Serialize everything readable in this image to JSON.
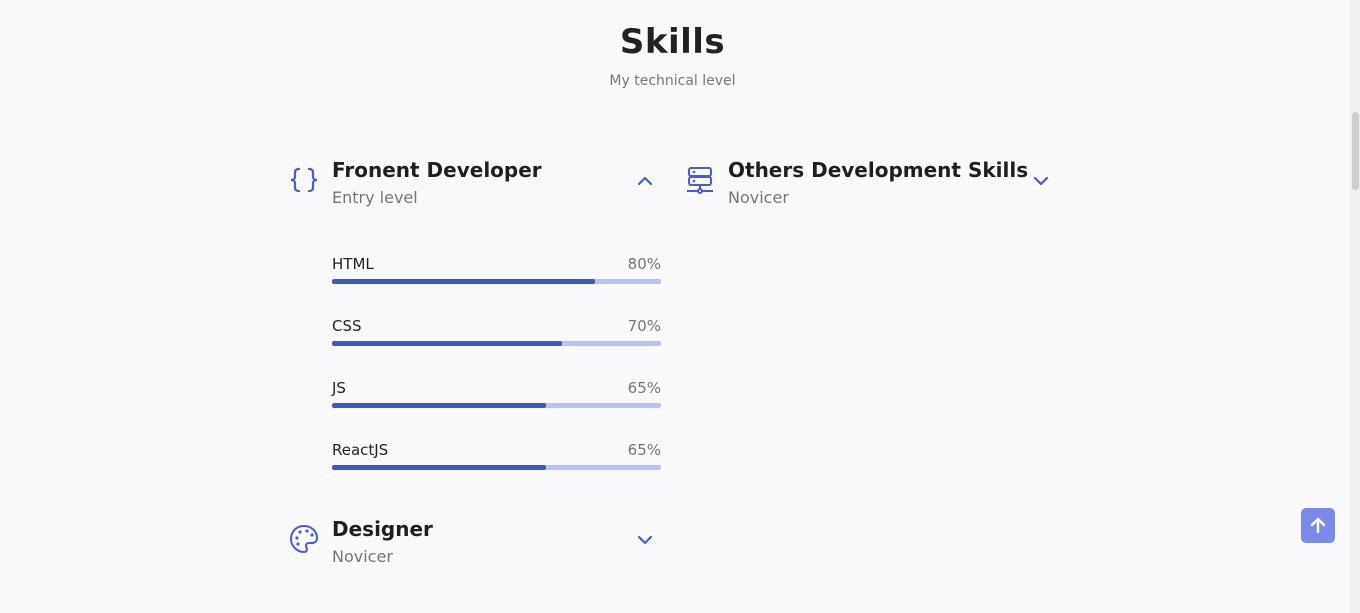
{
  "header": {
    "title": "Skills",
    "subtitle": "My technical level"
  },
  "sections": [
    {
      "title": "Fronent Developer",
      "subtitle": "Entry level",
      "icon": "code-braces-icon",
      "expanded": true,
      "skills": [
        {
          "name": "HTML",
          "percent": "80%",
          "value": 80
        },
        {
          "name": "CSS",
          "percent": "70%",
          "value": 70
        },
        {
          "name": "JS",
          "percent": "65%",
          "value": 65
        },
        {
          "name": "ReactJS",
          "percent": "65%",
          "value": 65
        }
      ]
    },
    {
      "title": "Others Development Skills",
      "subtitle": "Novicer",
      "icon": "server-network-icon",
      "expanded": false
    },
    {
      "title": "Designer",
      "subtitle": "Novicer",
      "icon": "palette-icon",
      "expanded": false
    }
  ],
  "colors": {
    "accent": "#4455c4",
    "bar_track": "#b9c1f5",
    "scroll_button": "#7b8ae8"
  },
  "scroll_up_button": {
    "icon": "arrow-up-icon"
  }
}
